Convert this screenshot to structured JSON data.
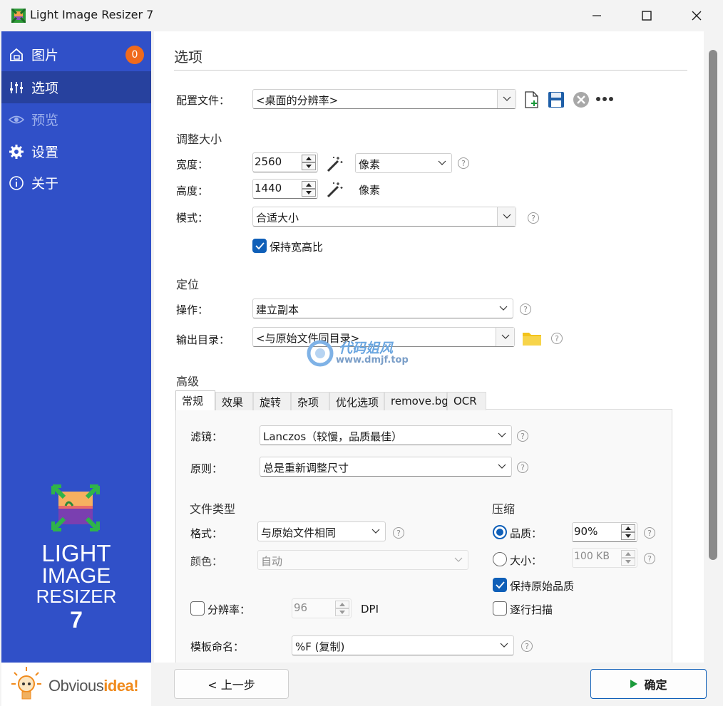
{
  "window": {
    "title": "Light Image Resizer 7"
  },
  "sidebar": {
    "items": [
      {
        "label": "图片",
        "badge": "0"
      },
      {
        "label": "选项"
      },
      {
        "label": "预览"
      },
      {
        "label": "设置"
      },
      {
        "label": "关于"
      }
    ],
    "logo": {
      "line1": "LIGHT",
      "line2": "IMAGE",
      "line3": "RESIZER",
      "line4": "7"
    },
    "brand": {
      "part1": "Obvious",
      "part2": "idea!"
    }
  },
  "main": {
    "heading": "选项",
    "profile": {
      "label": "配置文件：",
      "value": "<桌面的分辨率>"
    },
    "resize": {
      "title": "调整大小",
      "width_label": "宽度：",
      "width_value": "2560",
      "unit_select": "像素",
      "height_label": "高度：",
      "height_value": "1440",
      "height_unit": "像素",
      "mode_label": "模式：",
      "mode_value": "合适大小",
      "keep_ratio_label": "保持宽高比"
    },
    "target": {
      "title": "定位",
      "action_label": "操作：",
      "action_value": "建立副本",
      "output_label": "输出目录：",
      "output_value": "<与原始文件同目录>"
    },
    "advanced": {
      "title": "高级",
      "tabs": [
        "常规",
        "效果",
        "旋转",
        "杂项",
        "优化选项",
        "remove.bg",
        "OCR"
      ],
      "filter_label": "滤镜：",
      "filter_value": "Lanczos（较慢，品质最佳）",
      "rule_label": "原则：",
      "rule_value": "总是重新调整尺寸",
      "filetype": {
        "title": "文件类型",
        "format_label": "格式：",
        "format_value": "与原始文件相同",
        "color_label": "颜色：",
        "color_value": "自动",
        "resolution_label": "分辨率：",
        "resolution_value": "96",
        "resolution_unit": "DPI"
      },
      "compression": {
        "title": "压缩",
        "quality_label": "品质：",
        "quality_value": "90%",
        "size_label": "大小：",
        "size_value": "100 KB",
        "keep_quality_label": "保持原始品质",
        "progressive_label": "逐行扫描"
      },
      "naming_label": "模板命名：",
      "naming_value": "%F (复制)"
    }
  },
  "footer": {
    "back_label": "< 上一步",
    "ok_label": "确定"
  },
  "watermark": {
    "line1": "代码姐风",
    "line2": "www.dmjf.top"
  },
  "colors": {
    "sidebar": "#3050c8",
    "sidebar_active": "#27419e",
    "badge": "#f06a1c",
    "accent": "#0f5fb8",
    "ok_arrow": "#1a9a3a",
    "folder": "#f3c31b"
  }
}
